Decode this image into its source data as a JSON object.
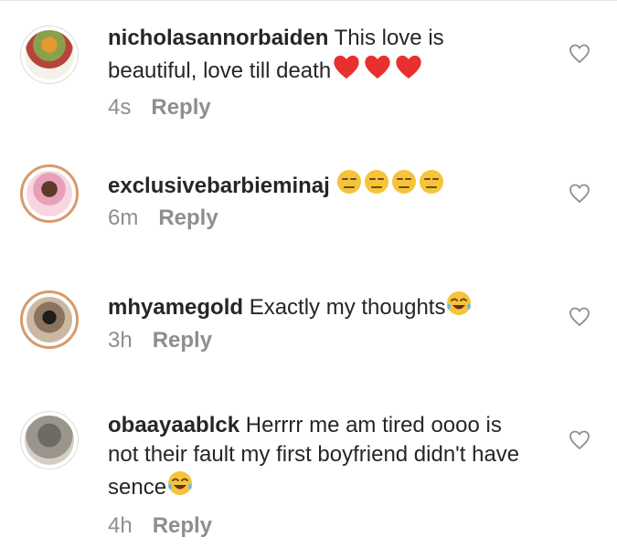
{
  "comments": [
    {
      "username": "nicholasannorbaiden",
      "text": " This love is beautiful, love till death",
      "emoji": [
        "red-heart",
        "red-heart",
        "red-heart"
      ],
      "time": "4s",
      "reply": "Reply"
    },
    {
      "username": "exclusivebarbieminaj",
      "text": " ",
      "emoji": [
        "unamused-face",
        "unamused-face",
        "unamused-face",
        "unamused-face"
      ],
      "time": "6m",
      "reply": "Reply"
    },
    {
      "username": "mhyamegold",
      "text": " Exactly my thoughts",
      "emoji": [
        "tears-of-joy-face"
      ],
      "time": "3h",
      "reply": "Reply"
    },
    {
      "username": "obaayaablck",
      "text": " Herrrr me am tired oooo is not their fault my first boyfriend didn't have sence",
      "emoji": [
        "tears-of-joy-face"
      ],
      "time": "4h",
      "reply": "Reply"
    }
  ],
  "icons": {
    "like": "heart-outline-icon"
  },
  "colors": {
    "username": "#262626",
    "meta": "#8e8e8e",
    "heart_emoji": "#e8302f",
    "emoji_face": "#f6c43a"
  }
}
